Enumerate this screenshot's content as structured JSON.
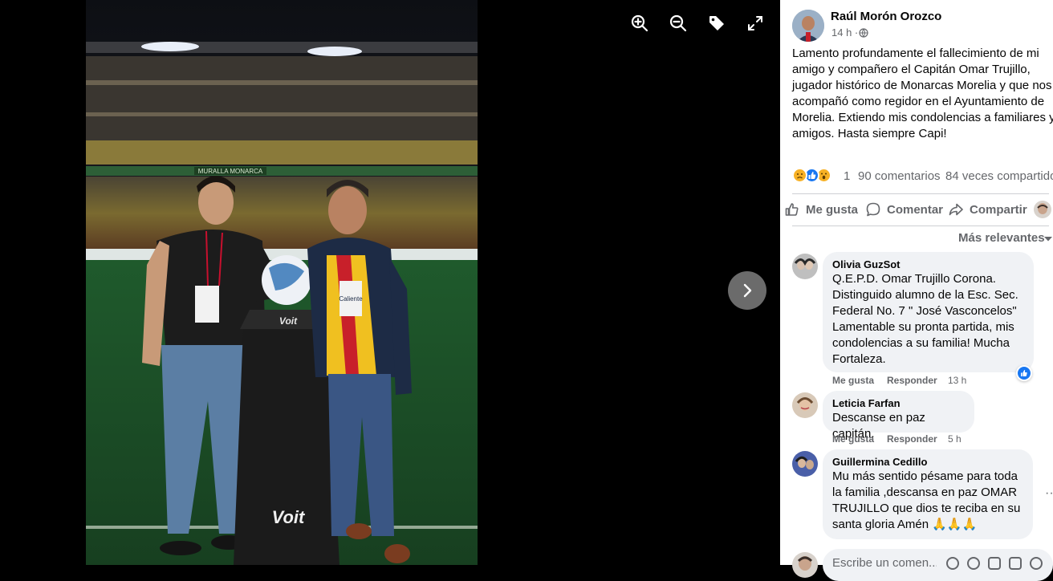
{
  "viewer": {
    "tools": [
      "zoom-in-icon",
      "zoom-out-icon",
      "tag-icon",
      "fullscreen-icon"
    ],
    "next_icon": "chevron-right-icon",
    "photo_texts": {
      "banner": "MURALLA MONARCA",
      "shirt": "Caliente",
      "pedestal_brand": "Voit",
      "pedestal_top_brand": "Voit"
    }
  },
  "post": {
    "author": "Raúl Morón Orozco",
    "time": "14 h ·",
    "privacy_icon": "globe-icon",
    "text": "Lamento profundamente el fallecimiento de mi amigo y compañero el Capitán Omar Trujillo, jugador histórico de Monarcas Morelia y que nos acompañó como regidor en el Ayuntamiento de Morelia. Extiendo mis condolencias a familiares y amigos. Hasta siempre Capi!",
    "reaction_count": "1",
    "comments": "90 comentarios",
    "shares": "84 veces compartido",
    "reaction_icons": [
      "sad-reaction-icon",
      "like-reaction-icon",
      "wow-reaction-icon"
    ]
  },
  "actions": {
    "like": "Me gusta",
    "comment": "Comentar",
    "share": "Compartir"
  },
  "sort": {
    "label": "Más relevantes"
  },
  "comments": [
    {
      "name": "Olivia GuzSot",
      "text": "Q.E.P.D. Omar Trujillo Corona.\nDistinguido alumno de la Esc. Sec.\nFederal No. 7 \" José Vasconcelos\"\nLamentable su pronta partida, mis\ncondolencias a su familia! Mucha\nFortaleza.",
      "like_label": "Me gusta",
      "reply_label": "Responder",
      "time": "13 h"
    },
    {
      "name": "Leticia Farfan",
      "text": "Descanse en paz capitán.",
      "like_label": "Me gusta",
      "reply_label": "Responder",
      "time": "5 h"
    },
    {
      "name": "Guillermina Cedillo",
      "text": "Mu más sentido pésame para toda\nla familia ,descansa en paz OMAR\nTRUJILLO que dios te reciba en su\nsanta gloria Amén 🙏🙏🙏"
    }
  ],
  "composer": {
    "placeholder": "Escribe un comen..."
  },
  "colors": {
    "facebook_blue": "#1877f2",
    "gray_text": "#65676b",
    "bubble": "#f0f2f5"
  }
}
